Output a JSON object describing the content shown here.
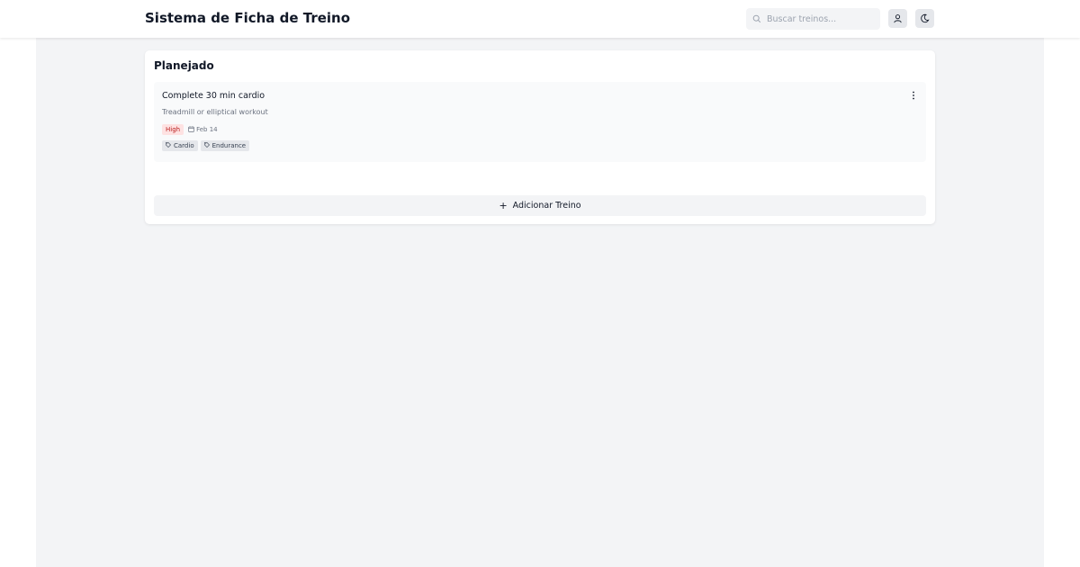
{
  "app": {
    "title": "Sistema de Ficha de Treino"
  },
  "search": {
    "placeholder": "Buscar treinos..."
  },
  "header_icons": [
    "search-icon",
    "user-icon",
    "moon-icon"
  ],
  "column": {
    "title": "Planejado",
    "cards": [
      {
        "title": "Complete 30 min cardio",
        "description": "Treadmill or elliptical workout",
        "priority": "High",
        "date": "Feb 14",
        "tags": [
          "Cardio",
          "Endurance"
        ]
      }
    ],
    "add_label": "Adicionar Treino"
  },
  "colors": {
    "background": "#f3f4f6",
    "priority_high_bg": "#fee2e2",
    "priority_high_text": "#b91c1c",
    "tag_bg": "#e5e7eb"
  }
}
